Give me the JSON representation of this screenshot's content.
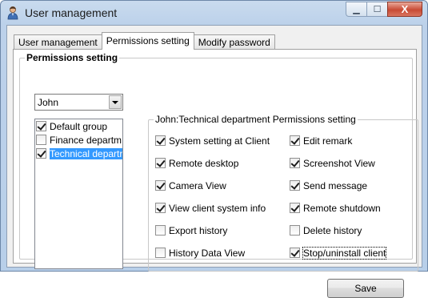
{
  "window": {
    "title": "User management",
    "buttons": {
      "minimize": "▁",
      "maximize": "☐",
      "close": "X"
    }
  },
  "tabs": [
    {
      "label": "User management",
      "active": false
    },
    {
      "label": "Permissions setting",
      "active": true
    },
    {
      "label": "Modify password",
      "active": false
    }
  ],
  "permissions_panel": {
    "group_label": "Permissions setting",
    "user_select": {
      "value": "John"
    },
    "groups": [
      {
        "label": "Default group",
        "checked": true,
        "selected": false
      },
      {
        "label": "Finance departm",
        "checked": false,
        "selected": false
      },
      {
        "label": "Technical departr",
        "checked": true,
        "selected": true
      }
    ],
    "permissions_title": "John:Technical department Permissions setting",
    "permissions": [
      {
        "label": "System setting at Client",
        "checked": true
      },
      {
        "label": "Edit remark",
        "checked": true
      },
      {
        "label": "Remote desktop",
        "checked": true
      },
      {
        "label": "Screenshot View",
        "checked": true
      },
      {
        "label": "Camera View",
        "checked": true
      },
      {
        "label": "Send message",
        "checked": true
      },
      {
        "label": "View client system info",
        "checked": true
      },
      {
        "label": "Remote shutdown",
        "checked": true
      },
      {
        "label": "Export history",
        "checked": false
      },
      {
        "label": "Delete history",
        "checked": false
      },
      {
        "label": "History Data View",
        "checked": false
      },
      {
        "label": "Stop/uninstall client",
        "checked": true
      }
    ],
    "save_label": "Save"
  },
  "icons": {
    "app": "user-icon",
    "dropdown": "chevron-down-icon"
  },
  "colors": {
    "selection": "#3399ff",
    "titlebar": "#bcd1ea",
    "close_button": "#c84a34"
  }
}
